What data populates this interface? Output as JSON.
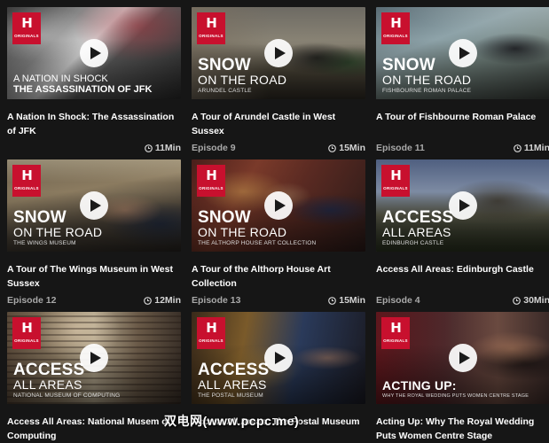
{
  "logo_mark": "H",
  "logo_text": "ORIGINALS",
  "play_icon": "play-icon",
  "clock_icon": "clock-icon",
  "cards": [
    {
      "title": "A Nation In Shock: The Assassination of JFK",
      "episode": "",
      "duration": "11Min",
      "overlay": {
        "line1": "A NATION IN SHOCK",
        "line2": "THE ASSASSINATION OF JFK"
      }
    },
    {
      "title": "A Tour of Arundel Castle in West Sussex",
      "episode": "Episode 9",
      "duration": "15Min",
      "overlay": {
        "big": "SNOW",
        "mid": "ON THE ROAD",
        "small": "ARUNDEL CASTLE"
      }
    },
    {
      "title": "A Tour of Fishbourne Roman Palace",
      "episode": "Episode 11",
      "duration": "11Min",
      "overlay": {
        "big": "SNOW",
        "mid": "ON THE ROAD",
        "small": "FISHBOURNE ROMAN PALACE"
      }
    },
    {
      "title": "A Tour of The Wings Museum in West Sussex",
      "episode": "Episode 12",
      "duration": "12Min",
      "overlay": {
        "big": "SNOW",
        "mid": "ON THE ROAD",
        "small": "THE WINGS MUSEUM"
      }
    },
    {
      "title": "A Tour of the Althorp House Art Collection",
      "episode": "Episode 13",
      "duration": "15Min",
      "overlay": {
        "big": "SNOW",
        "mid": "ON THE ROAD",
        "small": "THE ALTHORP HOUSE ART COLLECTION"
      }
    },
    {
      "title": "Access All Areas: Edinburgh Castle",
      "episode": "Episode 4",
      "duration": "30Min",
      "overlay": {
        "big": "ACCESS",
        "mid": "ALL AREAS",
        "small": "EDINBURGH CASTLE"
      }
    },
    {
      "title": "Access All Areas: National Musem of Computing",
      "episode": "",
      "duration": "",
      "overlay": {
        "big": "ACCESS",
        "mid": "ALL AREAS",
        "small": "NATIONAL MUSEUM OF COMPUTING"
      }
    },
    {
      "title": "Access All Areas: The Postal Museum",
      "episode": "",
      "duration": "",
      "overlay": {
        "big": "ACCESS",
        "mid": "ALL AREAS",
        "small": "THE POSTAL MUSEUM"
      }
    },
    {
      "title": "Acting Up: Why The Royal Wedding Puts Women Centre Stage",
      "episode": "",
      "duration": "",
      "overlay": {
        "big": "ACTING UP:",
        "small": "WHY THE ROYAL WEDDING PUTS WOMEN CENTRE STAGE"
      }
    }
  ],
  "watermark": "双电网(www.pcpc.me)"
}
